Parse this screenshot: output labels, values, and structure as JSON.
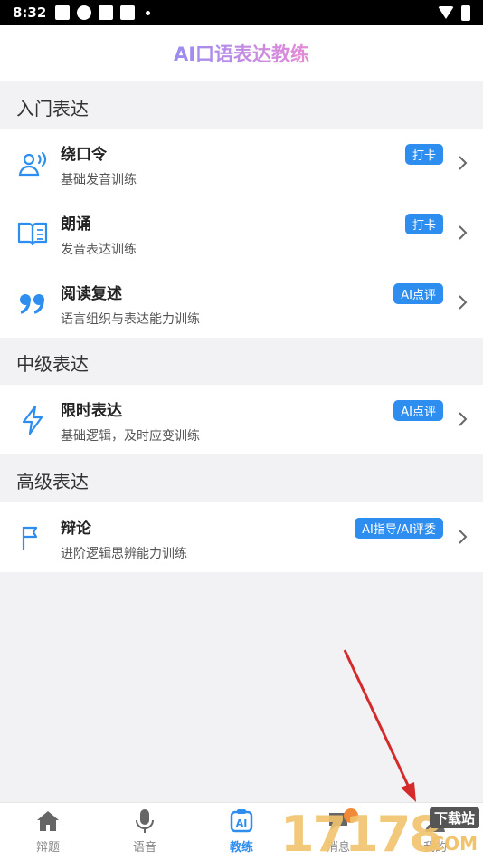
{
  "status_bar": {
    "time": "8:32"
  },
  "header": {
    "title": "AI口语表达教练"
  },
  "sections": [
    {
      "title": "入门表达",
      "items": [
        {
          "name": "绕口令",
          "desc": "基础发音训练",
          "badge": "打卡",
          "icon": "speaking-person-icon"
        },
        {
          "name": "朗诵",
          "desc": "发音表达训练",
          "badge": "打卡",
          "icon": "open-book-icon"
        },
        {
          "name": "阅读复述",
          "desc": "语言组织与表达能力训练",
          "badge": "AI点评",
          "icon": "quote-icon"
        }
      ]
    },
    {
      "title": "中级表达",
      "items": [
        {
          "name": "限时表达",
          "desc": "基础逻辑，及时应变训练",
          "badge": "AI点评",
          "icon": "lightning-icon"
        }
      ]
    },
    {
      "title": "高级表达",
      "items": [
        {
          "name": "辩论",
          "desc": "进阶逻辑思辨能力训练",
          "badge": "AI指导/AI评委",
          "icon": "flag-icon"
        }
      ]
    }
  ],
  "tabs": [
    {
      "label": "辩题",
      "icon": "home-icon"
    },
    {
      "label": "语音",
      "icon": "microphone-icon"
    },
    {
      "label": "教练",
      "icon": "ai-coach-icon",
      "active": true
    },
    {
      "label": "消息",
      "icon": "message-icon"
    },
    {
      "label": "我的",
      "icon": "person-icon"
    }
  ],
  "watermark": {
    "digits": "17178",
    "site": "下载站",
    "domain": ".COM"
  },
  "colors": {
    "accent": "#2e8ef0",
    "background": "#f2f2f4",
    "annotation_arrow": "#d42a2a"
  }
}
